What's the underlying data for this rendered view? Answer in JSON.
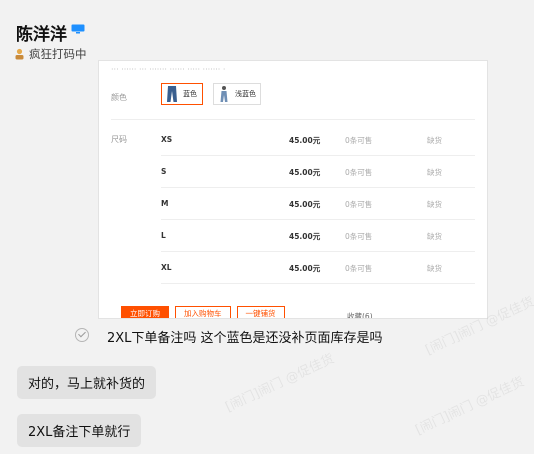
{
  "header": {
    "name": "陈洋洋",
    "status": "疯狂打码中",
    "device_icon": "desktop-icon",
    "status_icon": "coding-person-icon"
  },
  "product_shot": {
    "cut_off_row_text": "··· ······ ··· ······· ······ ····· ······· ·",
    "color_label": "颜色",
    "colors": [
      {
        "label": "蓝色",
        "selected": true
      },
      {
        "label": "浅蓝色",
        "selected": false
      }
    ],
    "size_label": "尺码",
    "sizes": [
      {
        "size": "XS",
        "price": "45.00元",
        "stock": "0条可售",
        "supply": "缺货"
      },
      {
        "size": "S",
        "price": "45.00元",
        "stock": "0条可售",
        "supply": "缺货"
      },
      {
        "size": "M",
        "price": "45.00元",
        "stock": "0条可售",
        "supply": "缺货"
      },
      {
        "size": "L",
        "price": "45.00元",
        "stock": "0条可售",
        "supply": "缺货"
      },
      {
        "size": "XL",
        "price": "45.00元",
        "stock": "0条可售",
        "supply": "缺货"
      }
    ],
    "buttons": {
      "order": "立即订购",
      "cart": "加入购物车",
      "sample": "一键铺货",
      "favorite": "收藏(6)"
    },
    "accent_color": "#ff5000"
  },
  "messages": {
    "quoted": "2XL下单备注吗 这个蓝色是还没补页面库存是吗",
    "reply1": "对的，马上就补货的",
    "reply2": "2XL备注下单就行"
  },
  "watermark": "[闹门]闹门 @促佳货"
}
